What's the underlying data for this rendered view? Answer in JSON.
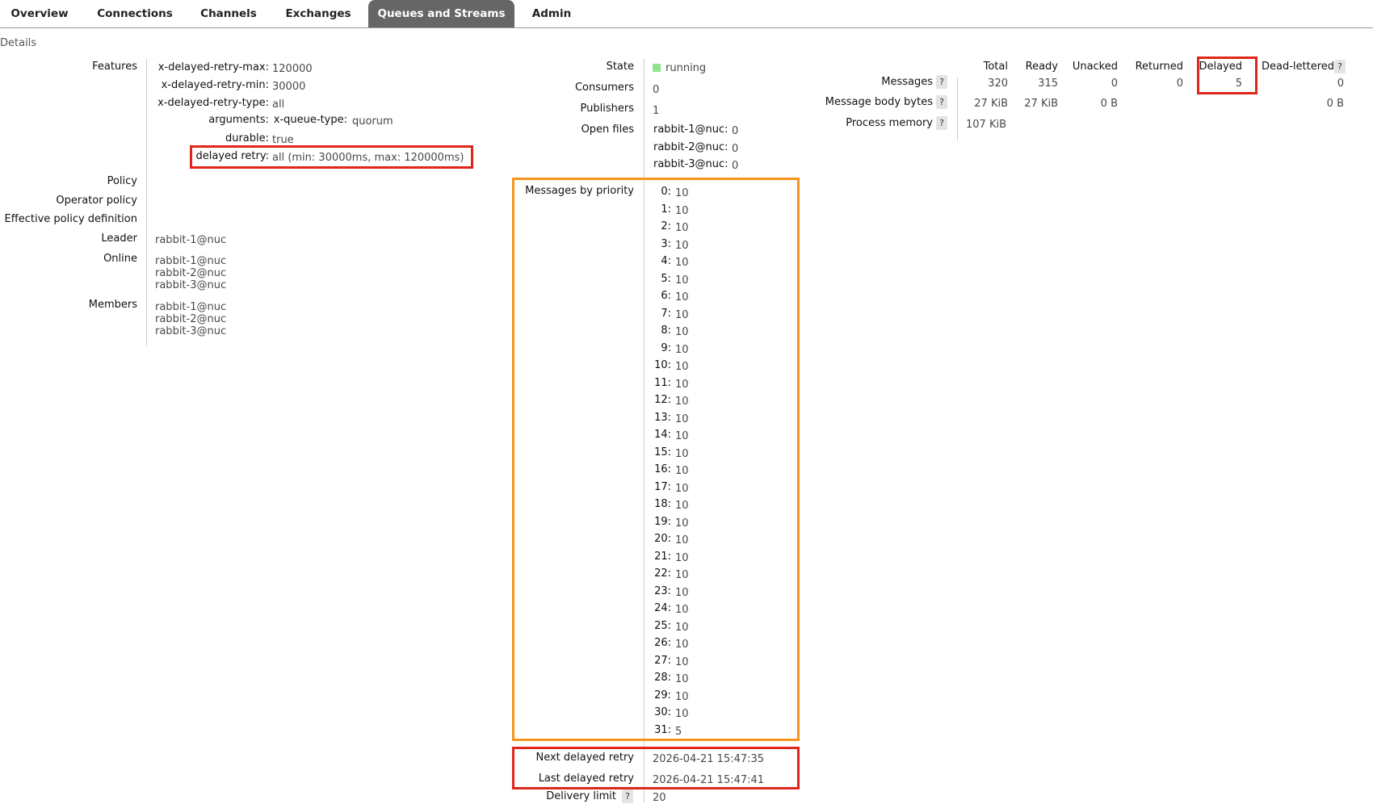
{
  "nav": {
    "tabs": [
      {
        "label": "Overview"
      },
      {
        "label": "Connections"
      },
      {
        "label": "Channels"
      },
      {
        "label": "Exchanges"
      },
      {
        "label": "Queues and Streams",
        "active": true
      },
      {
        "label": "Admin"
      }
    ]
  },
  "section_title": "Details",
  "left": {
    "features_label": "Features",
    "features": [
      {
        "key": "x-delayed-retry-max:",
        "value": "120000"
      },
      {
        "key": "x-delayed-retry-min:",
        "value": "30000"
      },
      {
        "key": "x-delayed-retry-type:",
        "value": "all"
      },
      {
        "key": "arguments:",
        "subkey": "x-queue-type:",
        "value": "quorum"
      },
      {
        "key": "durable:",
        "value": "true"
      },
      {
        "key": "delayed retry:",
        "value": "all (min: 30000ms, max: 120000ms)"
      }
    ],
    "policy_label": "Policy",
    "operator_policy_label": "Operator policy",
    "effective_policy_label": "Effective policy definition",
    "leader_label": "Leader",
    "leader_value": "rabbit-1@nuc",
    "online_label": "Online",
    "online": [
      "rabbit-1@nuc",
      "rabbit-2@nuc",
      "rabbit-3@nuc"
    ],
    "members_label": "Members",
    "members": [
      "rabbit-1@nuc",
      "rabbit-2@nuc",
      "rabbit-3@nuc"
    ]
  },
  "middle": {
    "state_label": "State",
    "state_value": "running",
    "state_color": "#8fe38f",
    "consumers_label": "Consumers",
    "consumers_value": "0",
    "publishers_label": "Publishers",
    "publishers_value": "1",
    "open_files_label": "Open files",
    "open_files": [
      {
        "node": "rabbit-1@nuc:",
        "value": "0"
      },
      {
        "node": "rabbit-2@nuc:",
        "value": "0"
      },
      {
        "node": "rabbit-3@nuc:",
        "value": "0"
      }
    ],
    "priority_label": "Messages by priority",
    "priorities": [
      {
        "p": "0:",
        "v": "10"
      },
      {
        "p": "1:",
        "v": "10"
      },
      {
        "p": "2:",
        "v": "10"
      },
      {
        "p": "3:",
        "v": "10"
      },
      {
        "p": "4:",
        "v": "10"
      },
      {
        "p": "5:",
        "v": "10"
      },
      {
        "p": "6:",
        "v": "10"
      },
      {
        "p": "7:",
        "v": "10"
      },
      {
        "p": "8:",
        "v": "10"
      },
      {
        "p": "9:",
        "v": "10"
      },
      {
        "p": "10:",
        "v": "10"
      },
      {
        "p": "11:",
        "v": "10"
      },
      {
        "p": "12:",
        "v": "10"
      },
      {
        "p": "13:",
        "v": "10"
      },
      {
        "p": "14:",
        "v": "10"
      },
      {
        "p": "15:",
        "v": "10"
      },
      {
        "p": "16:",
        "v": "10"
      },
      {
        "p": "17:",
        "v": "10"
      },
      {
        "p": "18:",
        "v": "10"
      },
      {
        "p": "19:",
        "v": "10"
      },
      {
        "p": "20:",
        "v": "10"
      },
      {
        "p": "21:",
        "v": "10"
      },
      {
        "p": "22:",
        "v": "10"
      },
      {
        "p": "23:",
        "v": "10"
      },
      {
        "p": "24:",
        "v": "10"
      },
      {
        "p": "25:",
        "v": "10"
      },
      {
        "p": "26:",
        "v": "10"
      },
      {
        "p": "27:",
        "v": "10"
      },
      {
        "p": "28:",
        "v": "10"
      },
      {
        "p": "29:",
        "v": "10"
      },
      {
        "p": "30:",
        "v": "10"
      },
      {
        "p": "31:",
        "v": "5"
      }
    ],
    "next_retry_label": "Next delayed retry",
    "next_retry_value": "2026-04-21 15:47:35",
    "last_retry_label": "Last delayed retry",
    "last_retry_value": "2026-04-21 15:47:41",
    "delivery_limit_label": "Delivery limit",
    "delivery_limit_value": "20"
  },
  "right": {
    "help": "?",
    "columns": [
      "Total",
      "Ready",
      "Unacked",
      "Returned",
      "Delayed",
      "Dead-lettered"
    ],
    "messages_label": "Messages",
    "messages": [
      "320",
      "315",
      "0",
      "0",
      "5",
      "0"
    ],
    "body_bytes_label": "Message body bytes",
    "body_bytes": [
      "27 KiB",
      "27 KiB",
      "0 B",
      "",
      "",
      "0 B"
    ],
    "process_memory_label": "Process memory",
    "process_memory": "107 KiB"
  },
  "highlight_colors": {
    "red": "#e0251b",
    "orange": "#f4951d"
  }
}
